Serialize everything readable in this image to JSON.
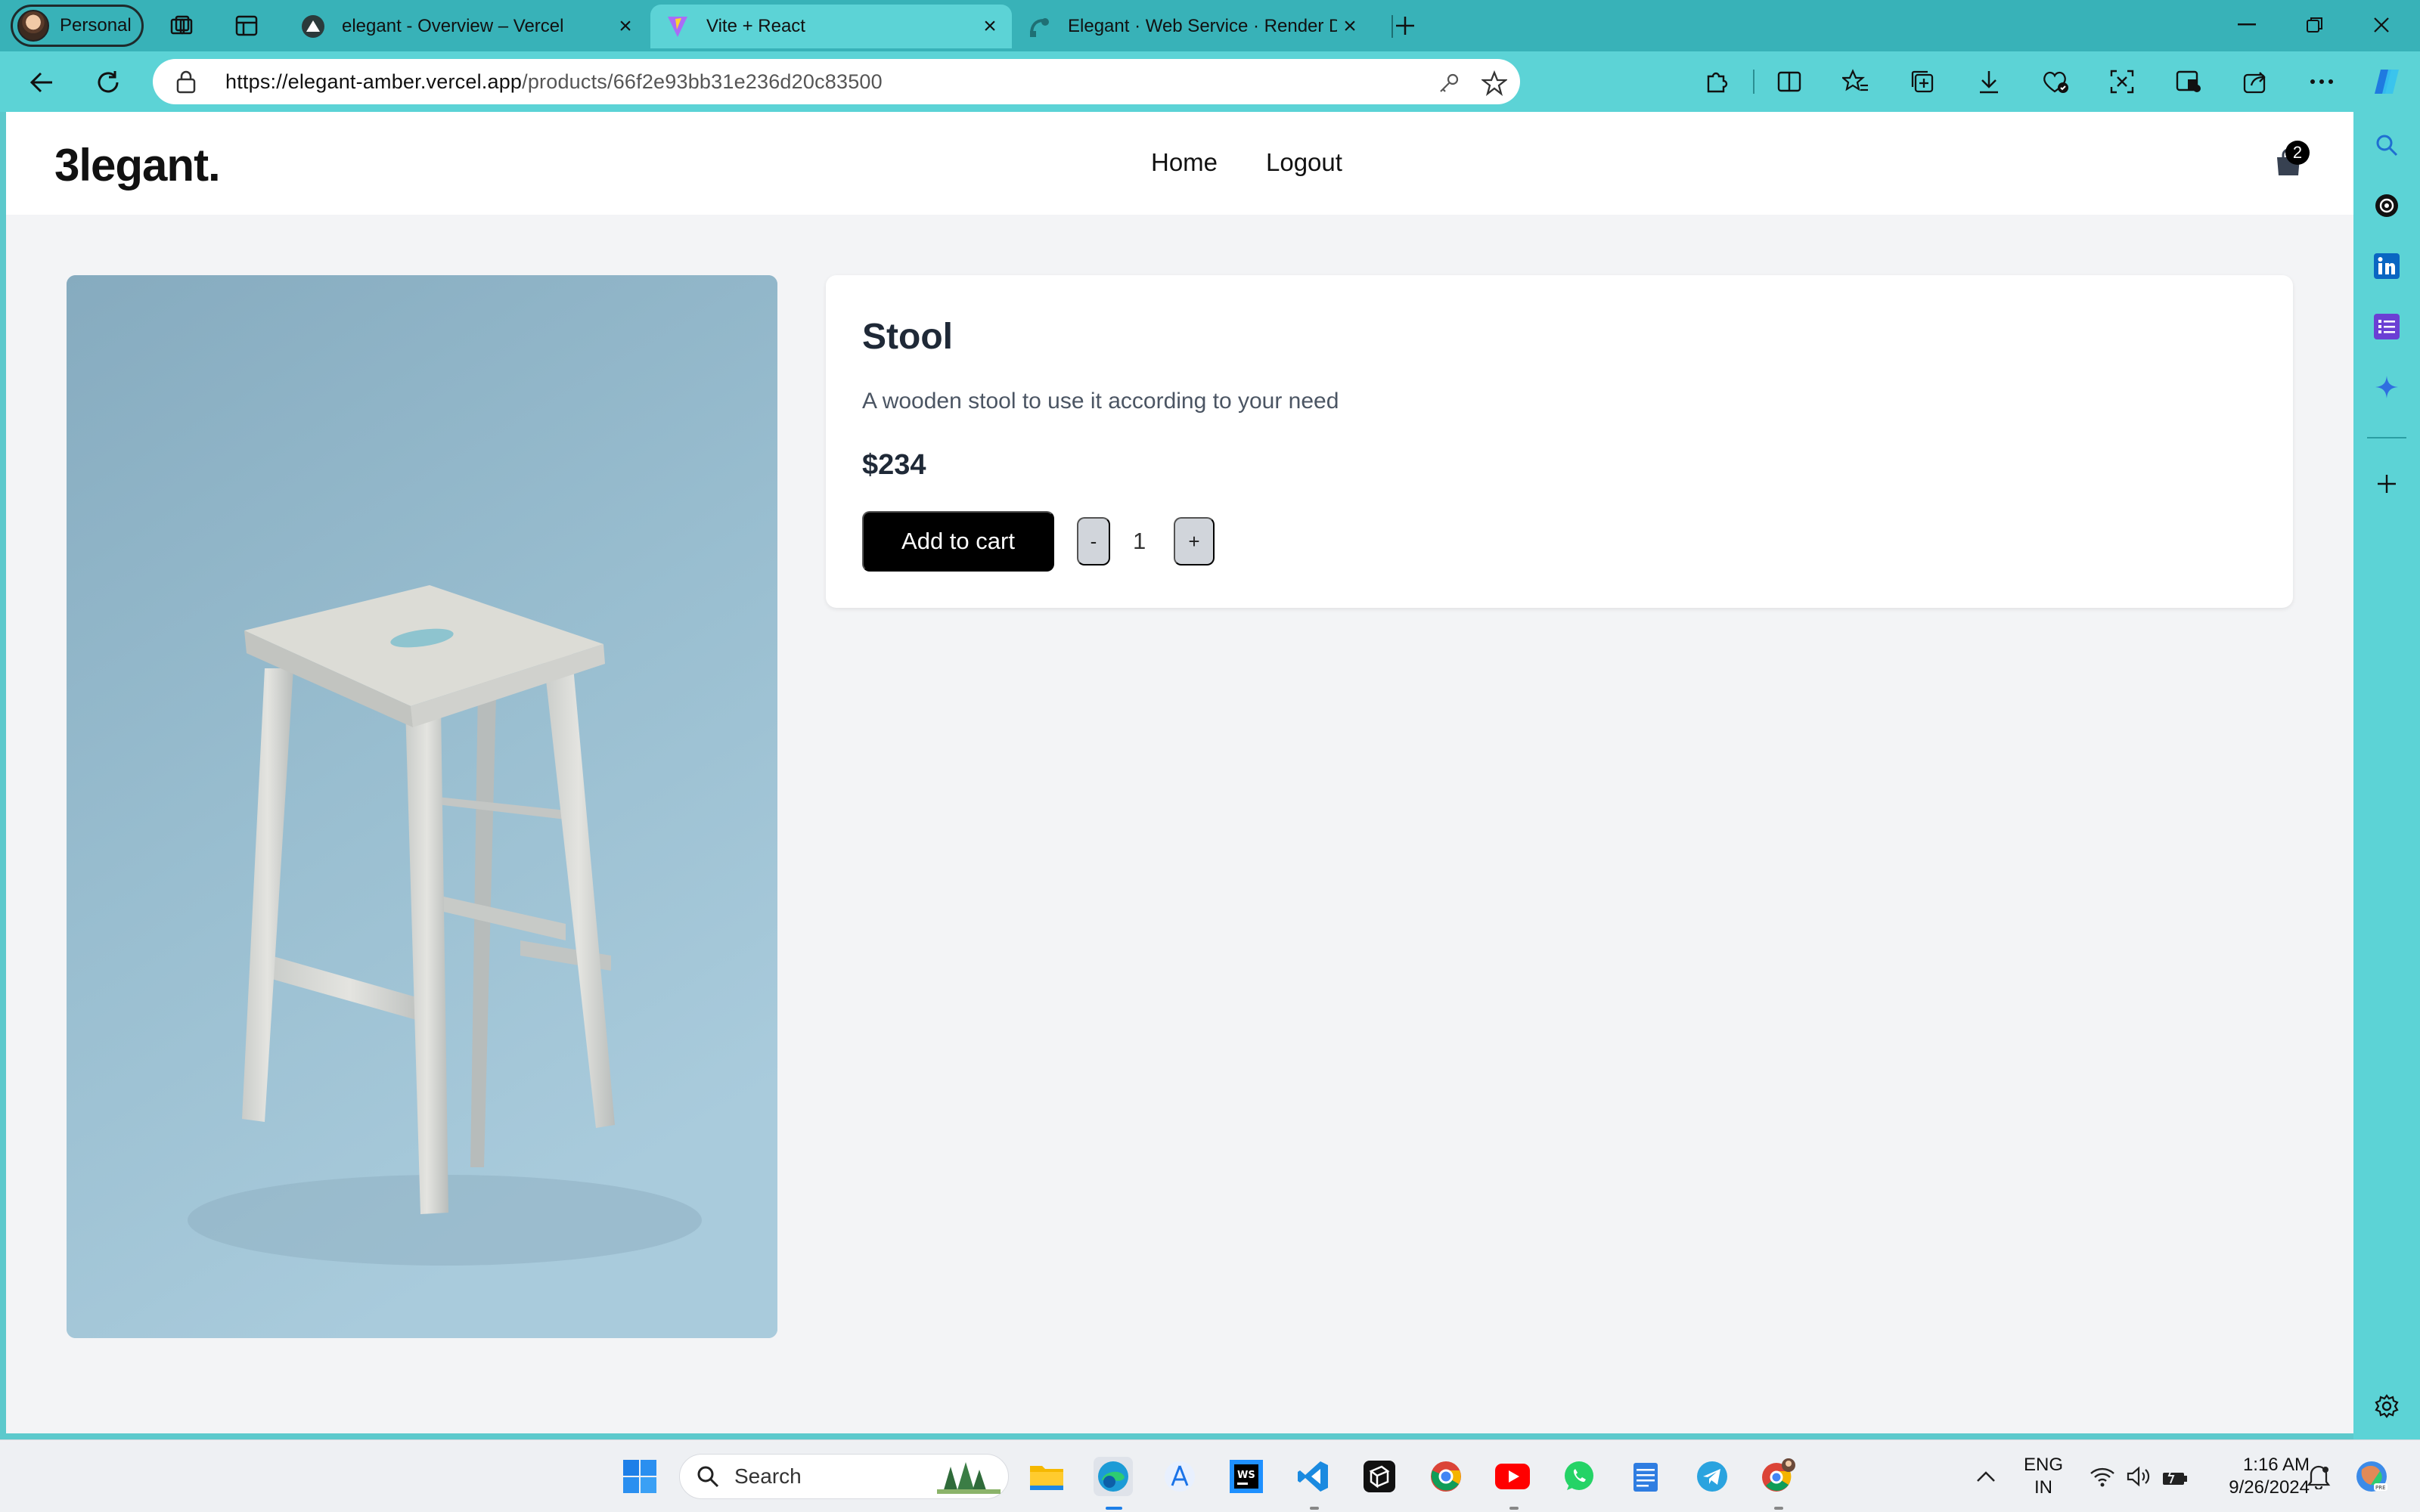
{
  "browser": {
    "profile_label": "Personal",
    "tabs": [
      {
        "title": "elegant - Overview – Vercel",
        "active": false
      },
      {
        "title": "Vite + React",
        "active": true
      },
      {
        "title": "Elegant · Web Service · Render D",
        "active": false
      }
    ],
    "url_host": "https://elegant-amber.vercel.app",
    "url_path": "/products/66f2e93bb31e236d20c83500"
  },
  "site": {
    "logo": "3legant.",
    "nav": {
      "home": "Home",
      "logout": "Logout"
    },
    "cart_count": "2"
  },
  "product": {
    "title": "Stool",
    "description": "A wooden stool to use it according to your need",
    "price": "$234",
    "add_to_cart": "Add to cart",
    "minus": "-",
    "plus": "+",
    "quantity": "1"
  },
  "taskbar": {
    "search_placeholder": "Search",
    "lang_line1": "ENG",
    "lang_line2": "IN",
    "time": "1:16 AM",
    "date": "9/26/2024"
  },
  "colors": {
    "browser_frame": "#5cd3d6",
    "tabstrip": "#38b2b8",
    "page_bg": "#f3f4f6",
    "button_black": "#000000",
    "image_bg": "#9cc1d2"
  }
}
